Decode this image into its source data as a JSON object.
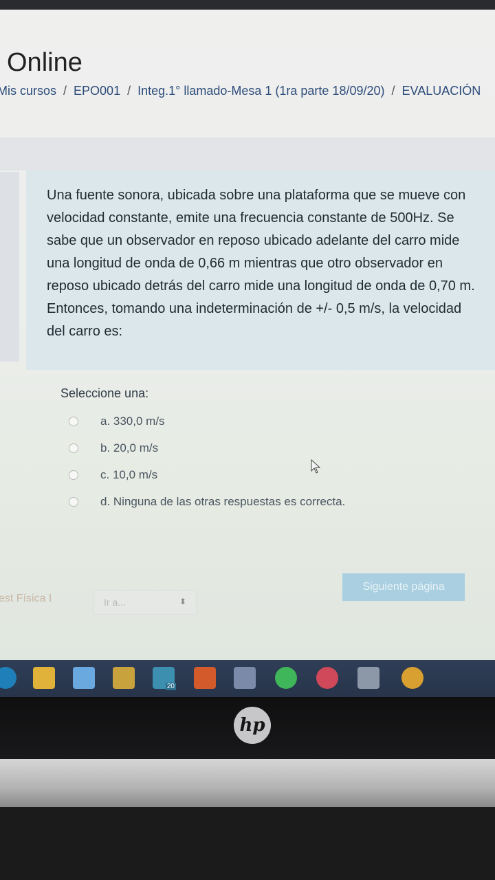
{
  "header": {
    "site_name": "Online",
    "breadcrumb": [
      "Mis cursos",
      "EPO001",
      "Integ.1° llamado-Mesa 1 (1ra parte 18/09/20)",
      "EVALUACIÓN"
    ]
  },
  "question": {
    "text": "Una fuente sonora, ubicada sobre una plataforma que se mueve con velocidad constante, emite una frecuencia constante de 500Hz. Se sabe que un observador en reposo ubicado adelante del carro mide una longitud de onda de 0,66 m mientras que otro observador en reposo ubicado detrás del carro mide una longitud de onda de 0,70 m. Entonces, tomando una indeterminación de +/- 0,5 m/s, la velocidad del carro es:",
    "prompt": "Seleccione una:",
    "options": [
      {
        "label": "a. 330,0 m/s"
      },
      {
        "label": "b. 20,0 m/s"
      },
      {
        "label": "c. 10,0 m/s"
      },
      {
        "label": "d. Ninguna de las otras respuestas es correcta."
      }
    ]
  },
  "navigation": {
    "next_label": "Siguiente página",
    "prev_link": "est Física I",
    "jump_placeholder": "Ir a...",
    "jump_arrows": "⬍"
  },
  "taskbar": {
    "icons": [
      {
        "name": "edge-icon",
        "color": "#1f7fb8"
      },
      {
        "name": "file-explorer-icon",
        "color": "#e0b23a"
      },
      {
        "name": "dropbox-icon",
        "color": "#6aa8e0"
      },
      {
        "name": "store-icon",
        "color": "#c8a23c"
      },
      {
        "name": "mail-icon",
        "color": "#3d8fb0"
      },
      {
        "name": "office-icon",
        "color": "#d35a2a"
      },
      {
        "name": "power-automate-icon",
        "color": "#7a8aa8"
      },
      {
        "name": "spotify-icon",
        "color": "#3fb65a"
      },
      {
        "name": "app-icon",
        "color": "#d0495a"
      },
      {
        "name": "window-icon",
        "color": "#8c97a8"
      },
      {
        "name": "chrome-icon",
        "color": "#d8a030"
      }
    ],
    "mail_badge": "20"
  },
  "device": {
    "logo": "hp"
  }
}
